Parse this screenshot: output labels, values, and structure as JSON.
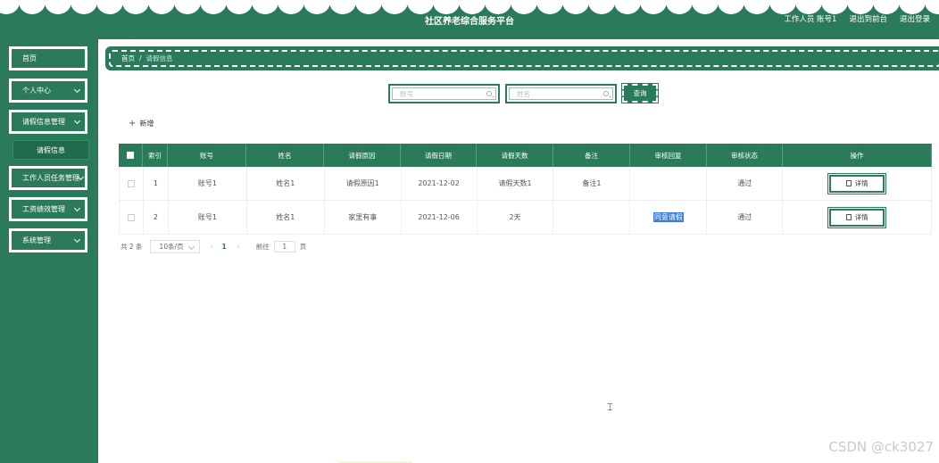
{
  "header": {
    "title": "社区养老综合服务平台",
    "user_info": "工作人员 账号1",
    "back_to_front": "退出到前台",
    "logout": "退出登录"
  },
  "sidebar": {
    "items": [
      {
        "label": "首页",
        "has_chevron": false
      },
      {
        "label": "个人中心",
        "has_chevron": true
      },
      {
        "label": "请假信息管理",
        "has_chevron": true
      },
      {
        "label": "请假信息",
        "submenu": true
      },
      {
        "label": "工作人员任务管理",
        "has_chevron": true
      },
      {
        "label": "工资绩效管理",
        "has_chevron": true
      },
      {
        "label": "系统管理",
        "has_chevron": true
      }
    ]
  },
  "breadcrumb": {
    "home": "首页",
    "separator": "/",
    "current": "请假信息"
  },
  "search": {
    "account_placeholder": "账号",
    "name_placeholder": "姓名",
    "query_label": "查询"
  },
  "toolbar": {
    "add_label": "新增"
  },
  "table": {
    "columns": [
      "索引",
      "账号",
      "姓名",
      "请假原因",
      "请假日期",
      "请假天数",
      "备注",
      "审核回复",
      "审核状态",
      "操作"
    ],
    "rows": [
      {
        "index": "1",
        "account": "账号1",
        "name": "姓名1",
        "reason": "请假原因1",
        "date": "2021-12-02",
        "days": "请假天数1",
        "remark": "备注1",
        "reply": "",
        "status": "通过",
        "action": "详情"
      },
      {
        "index": "2",
        "account": "账号1",
        "name": "姓名1",
        "reason": "家里有事",
        "date": "2021-12-06",
        "days": "2天",
        "remark": "",
        "reply": "同意请假",
        "status": "通过",
        "action": "详情"
      }
    ]
  },
  "pagination": {
    "total": "共 2 条",
    "page_size": "10条/页",
    "prev": "‹",
    "current_page": "1",
    "next": "›",
    "goto_label": "前往",
    "goto_value": "1",
    "goto_unit": "页"
  },
  "watermark": "CSDN @ck3027",
  "colors": {
    "primary": "#2b7a5a",
    "highlight": "#3c7dd9"
  }
}
